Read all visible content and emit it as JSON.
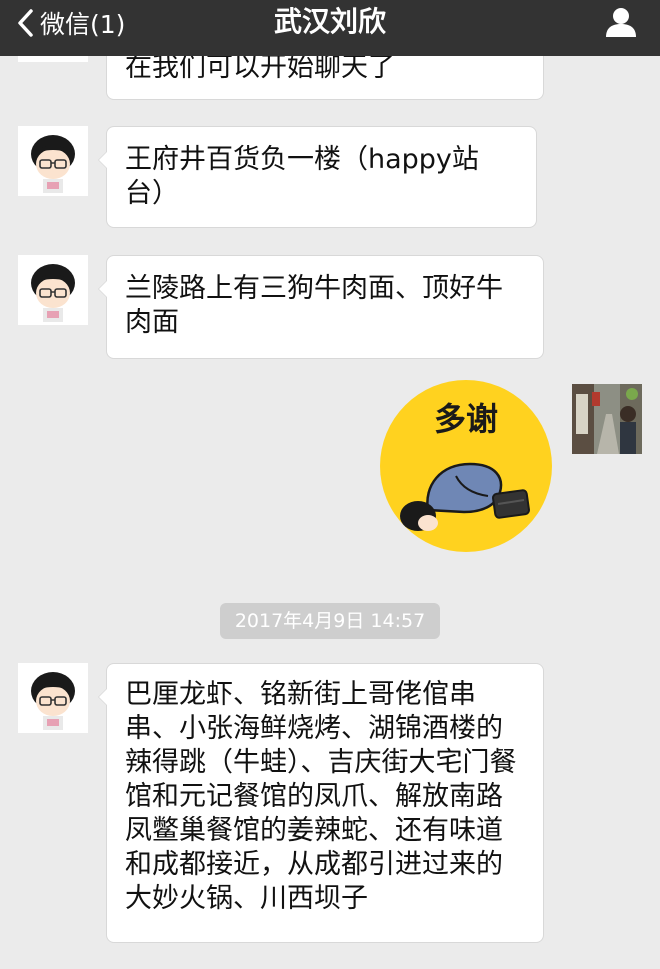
{
  "navbar": {
    "back_label": "微信(1)",
    "title": "武汉刘欣"
  },
  "messages": [
    {
      "side": "left",
      "text": "在我们可以开始聊天了"
    },
    {
      "side": "left",
      "text": "王府井百货负一楼（happy站台）"
    },
    {
      "side": "left",
      "text": "兰陵路上有三狗牛肉面、顶好牛肉面"
    },
    {
      "side": "right",
      "sticker_text": "多谢"
    },
    {
      "side": "left",
      "text": "巴厘龙虾、铭新街上哥佬倌串串、小张海鲜烧烤、湖锦酒楼的辣得跳（牛蛙）、吉庆街大宅门餐馆和元记餐馆的凤爪、解放南路凤鳖巢餐馆的姜辣蛇、还有味道和成都接近，从成都引进过来的大妙火锅、川西坝子"
    }
  ],
  "timestamp": "2017年4月9日 14:57",
  "colors": {
    "navbar_bg": "#333333",
    "chat_bg": "#ebebeb",
    "bubble_bg": "#ffffff",
    "timestamp_bg": "#cecece",
    "sticker_bg": "#ffd21f"
  },
  "icons": {
    "back": "chevron-left-icon",
    "profile": "person-icon"
  }
}
